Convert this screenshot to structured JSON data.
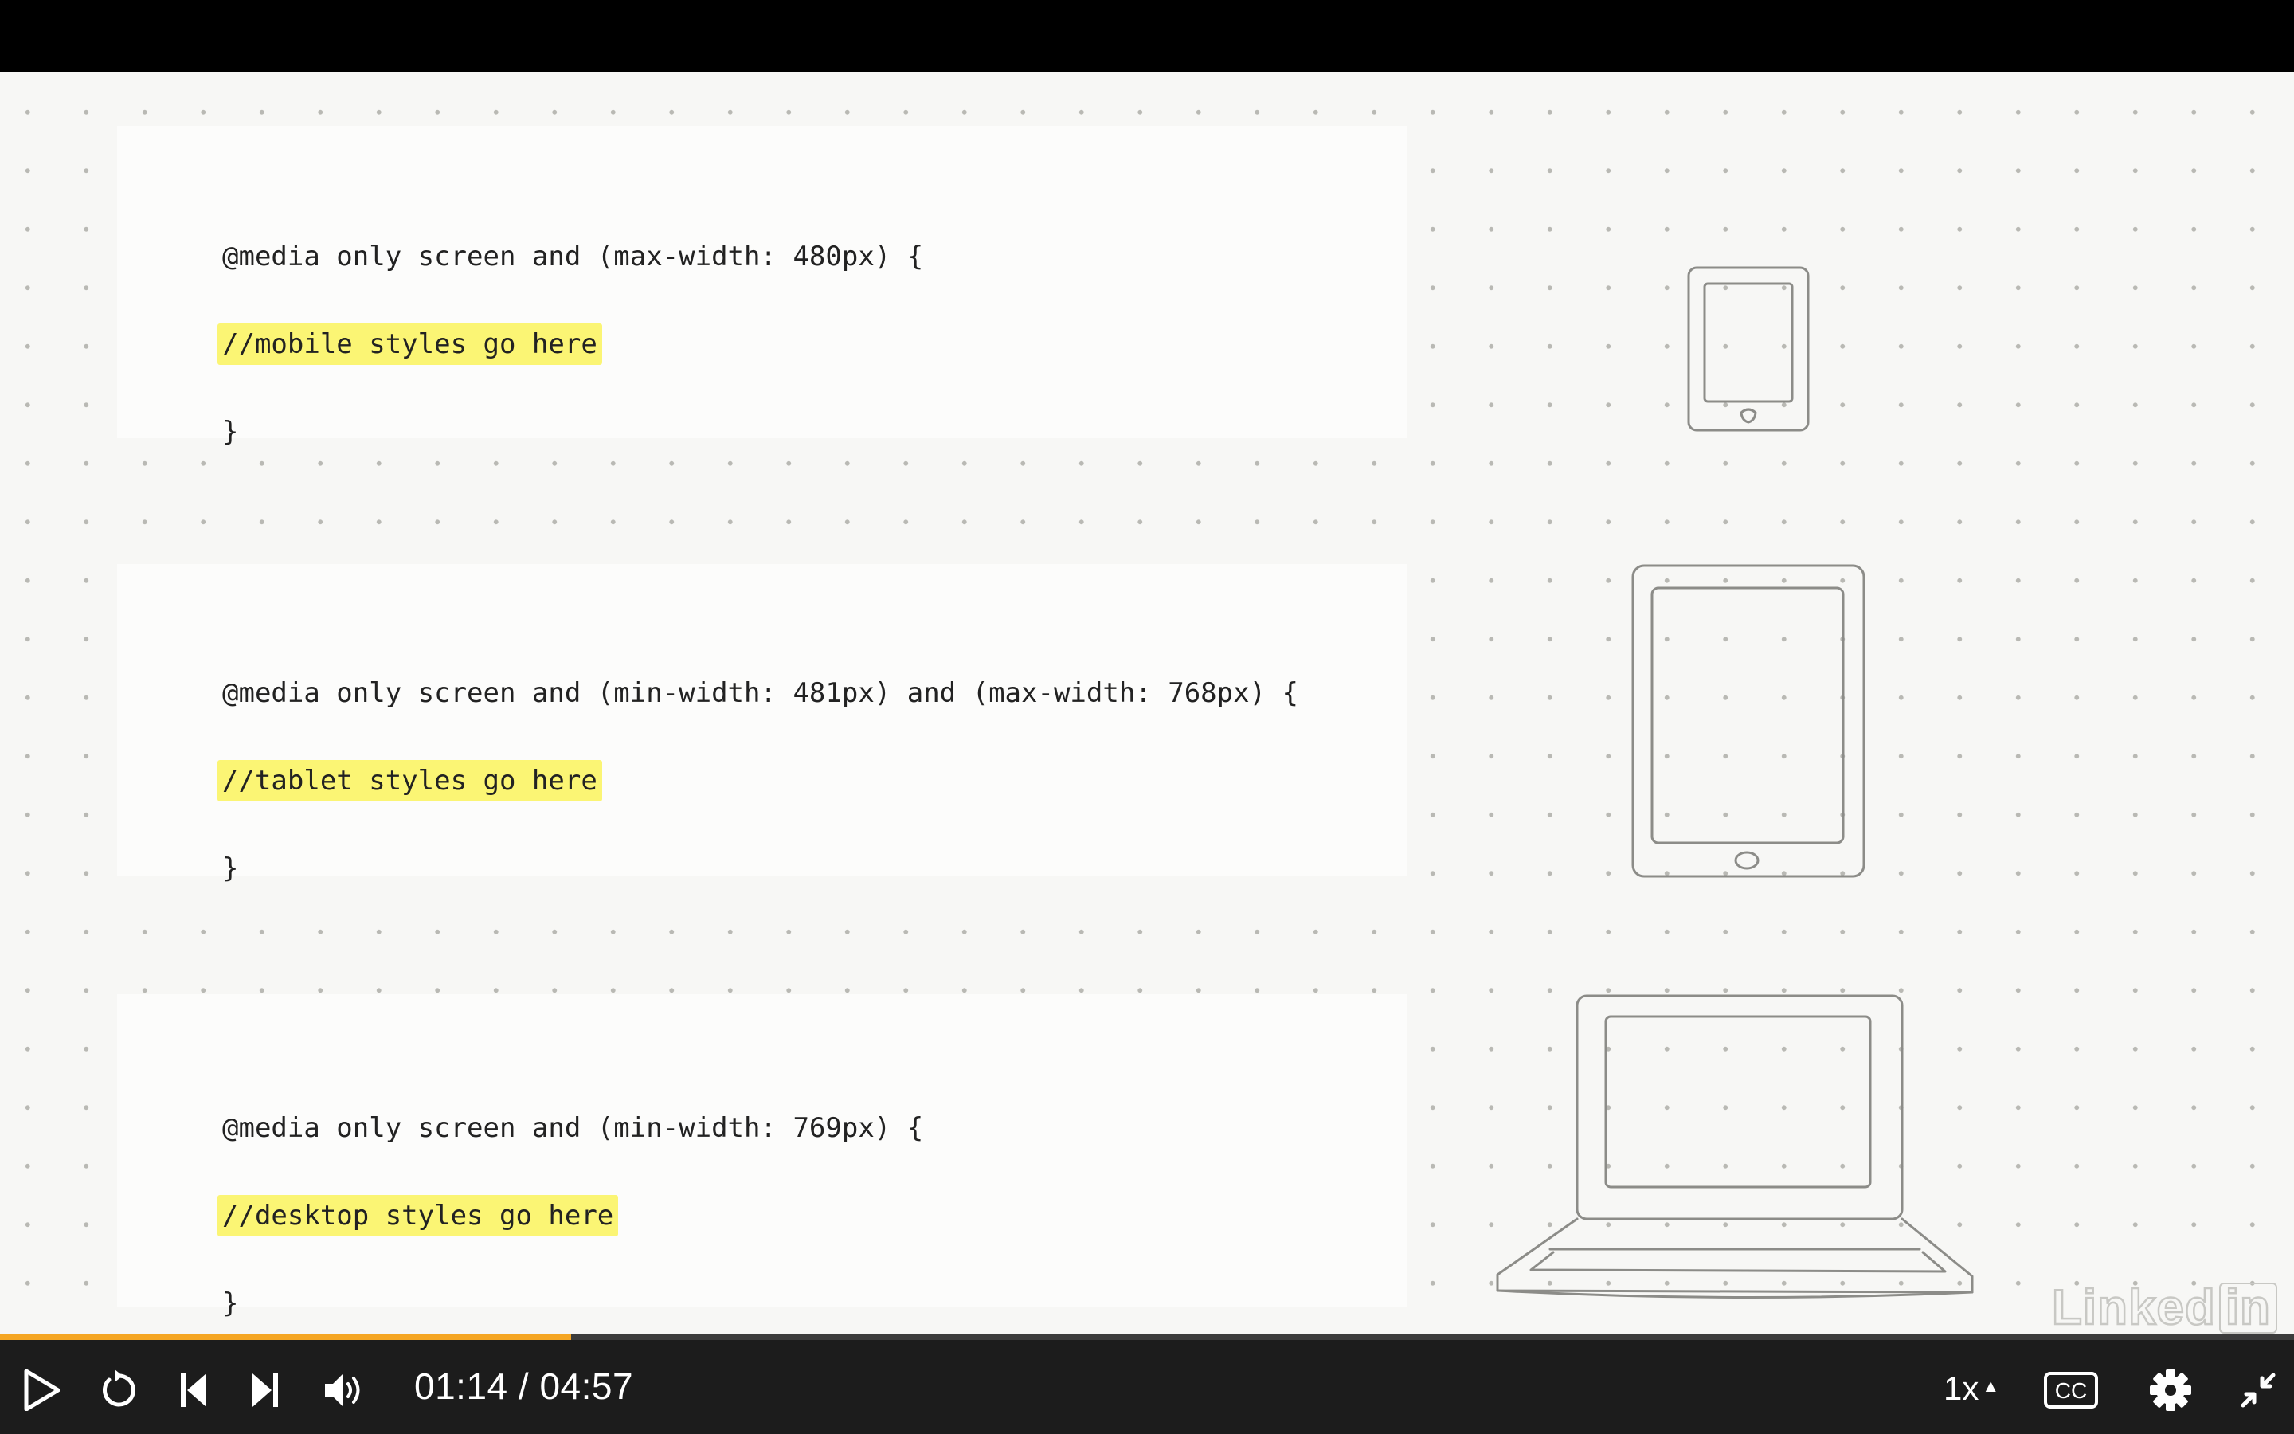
{
  "slide": {
    "blocks": [
      {
        "query": "@media only screen and (max-width: 480px) {",
        "comment": "//mobile styles go here",
        "close": "}"
      },
      {
        "query": "@media only screen and (min-width: 481px) and (max-width: 768px) {",
        "comment": "//tablet styles go here",
        "close": "}"
      },
      {
        "query": "@media only screen and (min-width: 769px) {",
        "comment": "//desktop styles go here",
        "close": "}"
      }
    ],
    "devices": [
      "phone-icon",
      "tablet-icon",
      "laptop-icon"
    ],
    "watermark": "Linkedin",
    "highlight_color": "#fbf574"
  },
  "player": {
    "current_time": "01:14",
    "separator": " / ",
    "duration": "04:57",
    "progress_fraction": 0.249,
    "progress_color": "#f5a623",
    "speed": "1x",
    "captions_label": "CC",
    "icons": [
      "play-icon",
      "replay-icon",
      "previous-icon",
      "next-icon",
      "volume-icon",
      "speed-caret-icon",
      "captions-icon",
      "settings-gear-icon",
      "exit-fullscreen-icon"
    ]
  }
}
